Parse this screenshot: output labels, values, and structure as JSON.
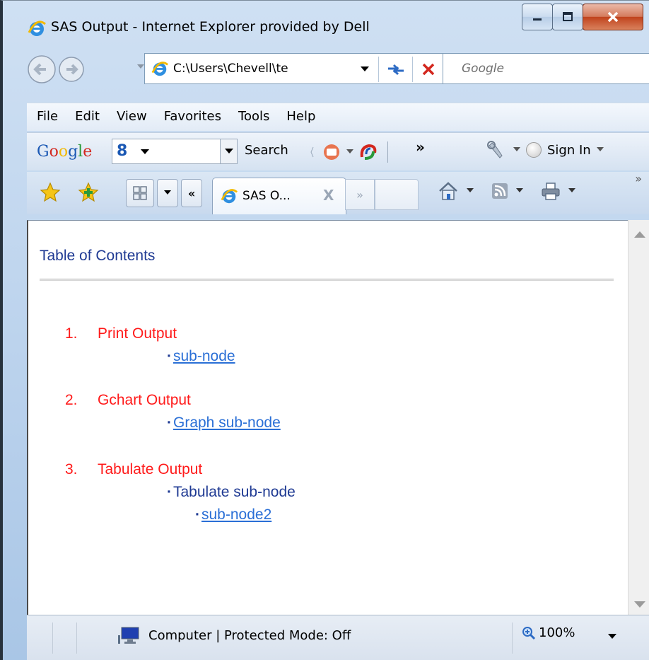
{
  "window": {
    "title": "SAS Output - Internet Explorer provided by Dell"
  },
  "address_bar": {
    "url": "C:\\Users\\Chevell\\te",
    "search_placeholder": "Google"
  },
  "menu": {
    "items": [
      "File",
      "Edit",
      "View",
      "Favorites",
      "Tools",
      "Help"
    ]
  },
  "google_toolbar": {
    "logo": "Google",
    "search_label": "Search",
    "more": "»",
    "sign_in": "Sign In"
  },
  "tabs": {
    "active_label": "SAS O...",
    "close_glyph": "X",
    "scroll_left": "«",
    "scroll_right": "»",
    "more": "»"
  },
  "content": {
    "toc_title": "Table of Contents",
    "items": [
      {
        "number": "1.",
        "label": "Print Output",
        "subs": [
          {
            "text": "sub-node",
            "link": true,
            "level": 1
          }
        ]
      },
      {
        "number": "2.",
        "label": "Gchart Output",
        "subs": [
          {
            "text": "Graph sub-node",
            "link": true,
            "level": 1
          }
        ]
      },
      {
        "number": "3.",
        "label": "Tabulate Output",
        "subs": [
          {
            "text": "Tabulate sub-node",
            "link": false,
            "level": 1
          },
          {
            "text": "sub-node2",
            "link": true,
            "level": 2
          }
        ]
      }
    ],
    "bullet": "·"
  },
  "status_bar": {
    "zone_text": "Computer | Protected Mode: Off",
    "zoom": "100%"
  },
  "colors": {
    "toc_heading": "#1f3a93",
    "toc_item": "#ff1a1a",
    "link": "#2a6fd6"
  }
}
